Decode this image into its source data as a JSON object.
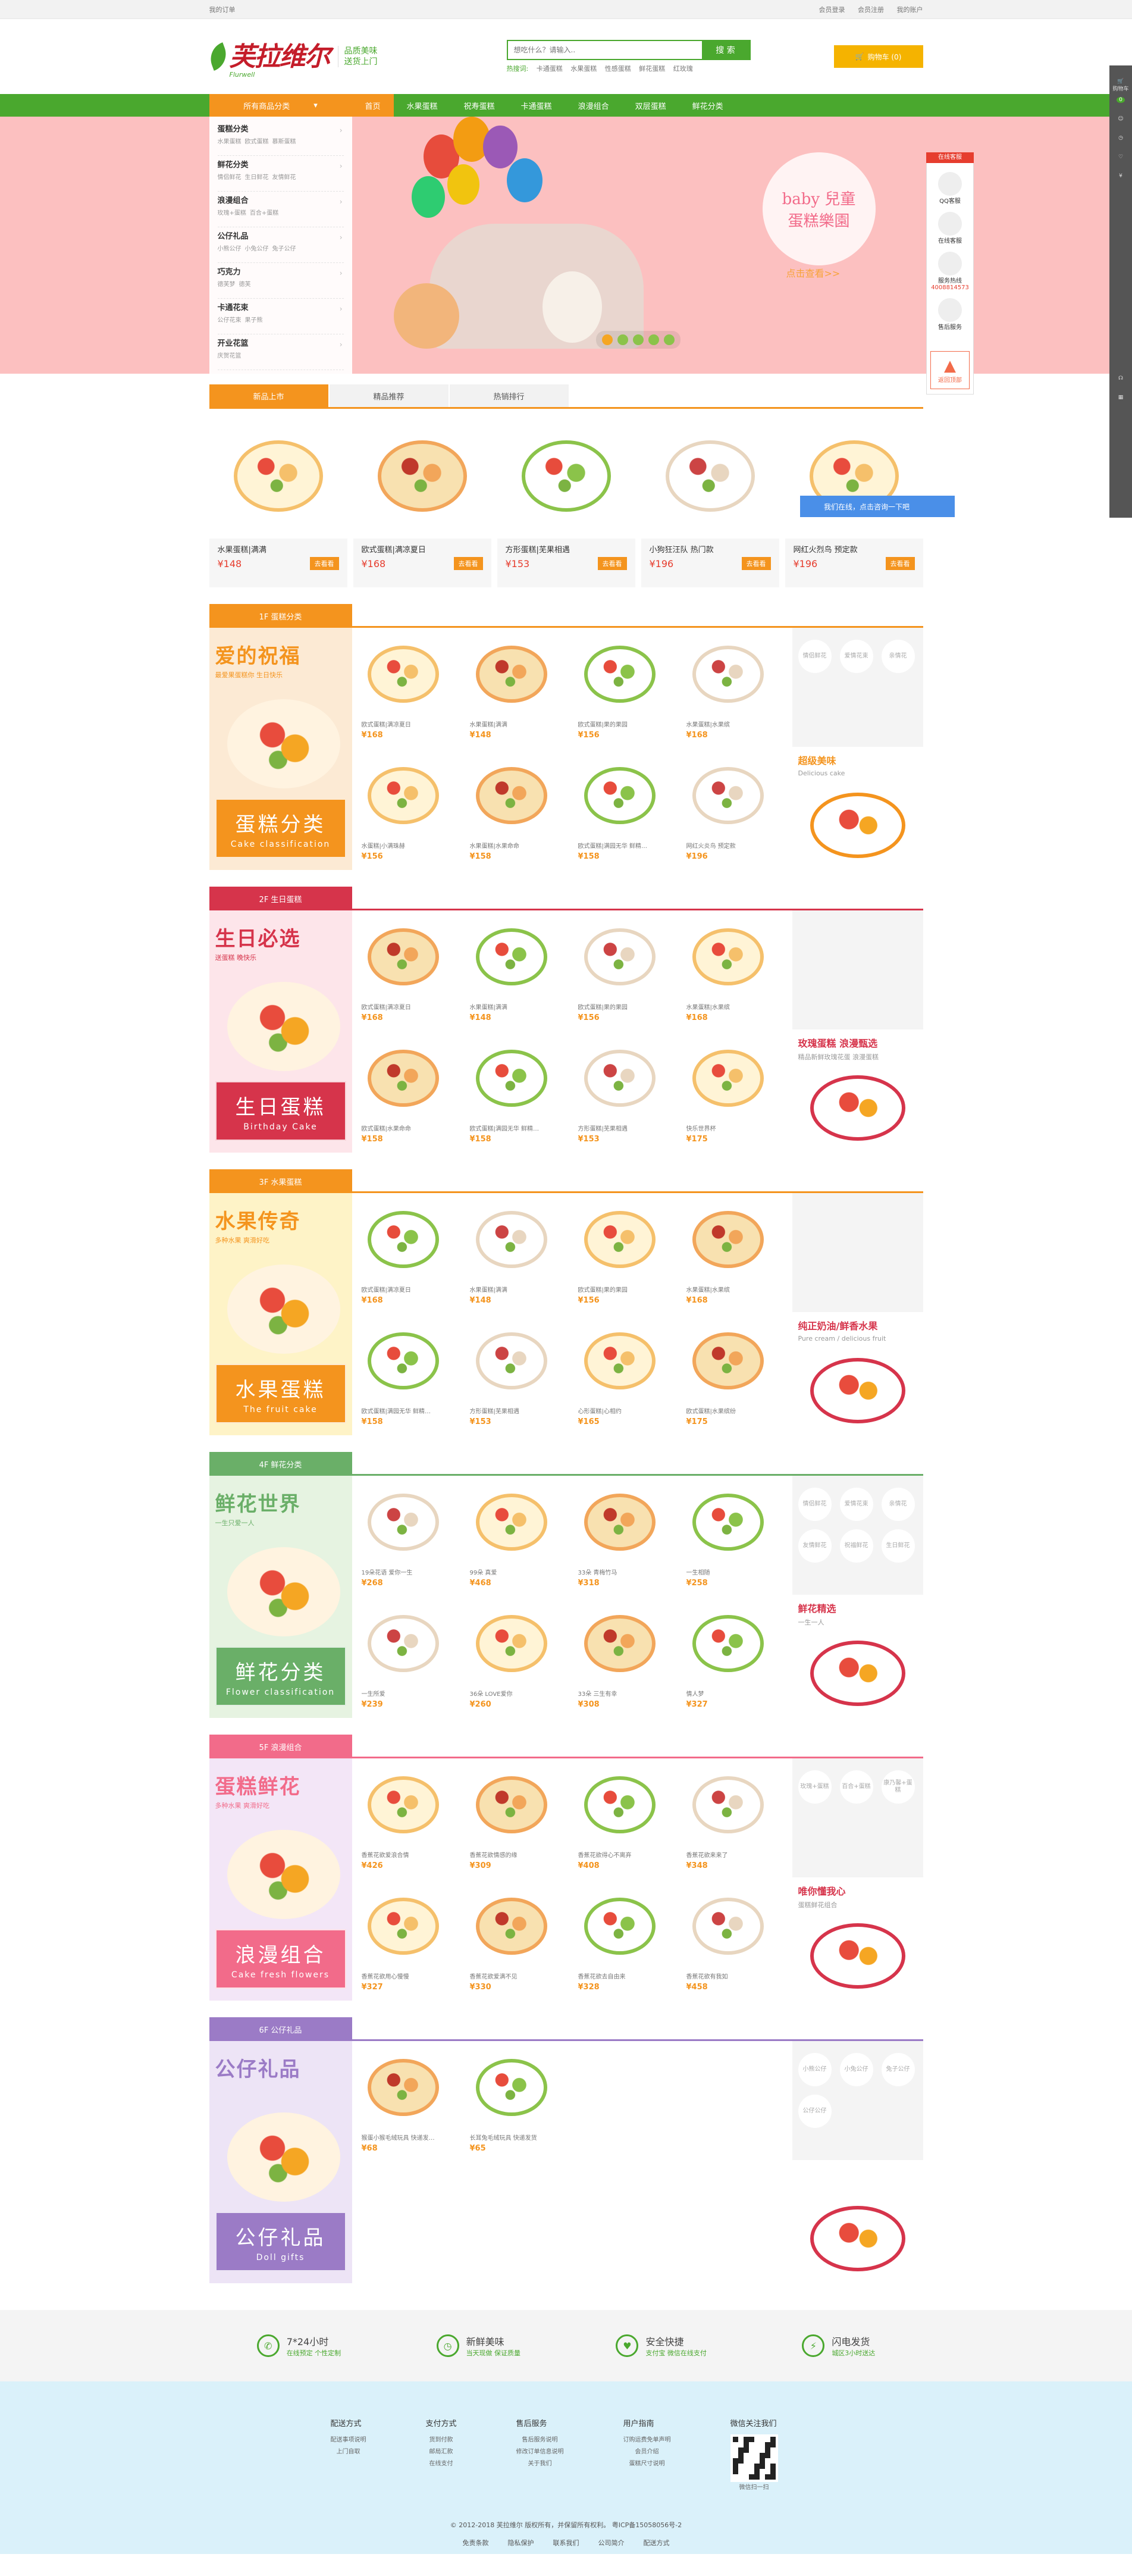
{
  "topbar": {
    "left": "我的订单",
    "links": [
      "会员登录",
      "会员注册",
      "我的账户"
    ]
  },
  "logo": {
    "brand": "芙拉维尔",
    "en": "Flurwell",
    "slogan1": "品质美味",
    "slogan2": "送货上门"
  },
  "search": {
    "placeholder": "想吃什么？请输入..",
    "button": "搜 索",
    "hot": [
      "热搜词:",
      "卡通蛋糕",
      "水果蛋糕",
      "性感蛋糕",
      "鲜花蛋糕",
      "红玫瑰"
    ]
  },
  "cart": {
    "label": "购物车 (0)"
  },
  "nav": {
    "category": "所有商品分类",
    "items": [
      "首页",
      "水果蛋糕",
      "祝寿蛋糕",
      "卡通蛋糕",
      "浪漫组合",
      "双层蛋糕",
      "鲜花分类"
    ]
  },
  "sidebar": [
    {
      "title": "蛋糕分类",
      "subs": [
        "水果蛋糕",
        "欧式蛋糕",
        "慕斯蛋糕"
      ]
    },
    {
      "title": "鲜花分类",
      "subs": [
        "情侣鲜花",
        "生日鲜花",
        "友情鲜花"
      ]
    },
    {
      "title": "浪漫组合",
      "subs": [
        "玫瑰+蛋糕",
        "百合+蛋糕"
      ]
    },
    {
      "title": "公仔礼品",
      "subs": [
        "小熊公仔",
        "小兔公仔",
        "兔子公仔"
      ]
    },
    {
      "title": "巧克力",
      "subs": [
        "德芙梦",
        "德芙"
      ]
    },
    {
      "title": "卡通花束",
      "subs": [
        "公仔花束",
        "果子熊"
      ]
    },
    {
      "title": "开业花篮",
      "subs": [
        "庆贺花篮"
      ]
    }
  ],
  "banner": {
    "title1": "baby 兒童",
    "title2": "蛋糕樂園",
    "sub": "点击查看>>"
  },
  "tabs": [
    "新品上市",
    "精品推荐",
    "热销排行"
  ],
  "new_products": [
    {
      "name": "水果蛋糕|满满",
      "price": "¥148",
      "btn": "去看看"
    },
    {
      "name": "欧式蛋糕|满凉夏日",
      "price": "¥168",
      "btn": "去看看"
    },
    {
      "name": "方形蛋糕|芜果相遇",
      "price": "¥153",
      "btn": "去看看"
    },
    {
      "name": "小狗狂汪队 热门款",
      "price": "¥196",
      "btn": "去看看"
    },
    {
      "name": "网红火烈鸟 预定款",
      "price": "¥196",
      "btn": "去看看"
    }
  ],
  "chat": "我们在线，点击咨询一下吧",
  "floors": [
    {
      "tag": "1F 蛋糕分类",
      "color": "#f4941e",
      "title": "爱的祝福",
      "sub": "最爱果蛋糕你 生日快乐",
      "label_cn": "蛋糕分类",
      "label_en": "Cake classification",
      "bg": "#fcead4",
      "items": [
        [
          "欧式蛋糕|满凉夏日",
          "¥168"
        ],
        [
          "水果蛋糕|满满",
          "¥148"
        ],
        [
          "欧式蛋糕|果的果园",
          "¥156"
        ],
        [
          "水果蛋糕|水果缤",
          "¥168"
        ],
        [
          "水蛋糕|小满珠赫",
          "¥156"
        ],
        [
          "水果蛋糕|水果命命",
          "¥158"
        ],
        [
          "欧式蛋糕|满园无华 鲜精…",
          "¥158"
        ],
        [
          "网红火炎鸟 预定款",
          "¥196"
        ]
      ],
      "tags": [
        "情侣鲜花",
        "爱情花束",
        "亲情花"
      ],
      "pt": "超级美味",
      "ps": "Delicious cake",
      "pcolor": "#f4941e"
    },
    {
      "tag": "2F 生日蛋糕",
      "color": "#d6344b",
      "title": "生日必选",
      "sub": "送蛋糕 晚快乐",
      "label_cn": "生日蛋糕",
      "label_en": "Birthday Cake",
      "bg": "#fde5ea",
      "items": [
        [
          "欧式蛋糕|满凉夏日",
          "¥168"
        ],
        [
          "水果蛋糕|满满",
          "¥148"
        ],
        [
          "欧式蛋糕|果的果园",
          "¥156"
        ],
        [
          "水果蛋糕|水果缤",
          "¥168"
        ],
        [
          "欧式蛋糕|水果命命",
          "¥158"
        ],
        [
          "欧式蛋糕|满园无华 鲜精…",
          "¥158"
        ],
        [
          "方形蛋糕|芜果相遇",
          "¥153"
        ],
        [
          "快乐世界杯",
          "¥175"
        ]
      ],
      "tags": [],
      "pt": "玫瑰蛋糕 浪漫甄选",
      "ps": "精品新鲜玫瑰花蛋 浪漫蛋糕",
      "pcolor": "#d6344b"
    },
    {
      "tag": "3F 水果蛋糕",
      "color": "#f4941e",
      "title": "水果传奇",
      "sub": "多种水果 爽滑好吃",
      "label_cn": "水果蛋糕",
      "label_en": "The fruit cake",
      "bg": "#fef3c7",
      "items": [
        [
          "欧式蛋糕|满凉夏日",
          "¥168"
        ],
        [
          "水果蛋糕|满满",
          "¥148"
        ],
        [
          "欧式蛋糕|果的果园",
          "¥156"
        ],
        [
          "水果蛋糕|水果缤",
          "¥168"
        ],
        [
          "欧式蛋糕|满园无华 鲜精…",
          "¥158"
        ],
        [
          "方形蛋糕|芜果相遇",
          "¥153"
        ],
        [
          "心形蛋糕|心相约",
          "¥165"
        ],
        [
          "欧式蛋糕|水果缤纷",
          "¥175"
        ]
      ],
      "tags": [],
      "pt": "纯正奶油/鲜香水果",
      "ps": "Pure cream / delicious fruit",
      "pcolor": "#d6344b"
    },
    {
      "tag": "4F 鲜花分类",
      "color": "#6aaf68",
      "title": "鲜花世界",
      "sub": "一生只爱一人",
      "label_cn": "鲜花分类",
      "label_en": "Flower classification",
      "bg": "#e6f3e1",
      "items": [
        [
          "19朵花语 爱你一生",
          "¥268"
        ],
        [
          "99朵 真爱",
          "¥468"
        ],
        [
          "33朵 青梅竹马",
          "¥318"
        ],
        [
          "一生相随",
          "¥258"
        ],
        [
          "一生所爱",
          "¥239"
        ],
        [
          "36朵 LOVE爱你",
          "¥260"
        ],
        [
          "33朵 三生有幸",
          "¥308"
        ],
        [
          "情人梦",
          "¥327"
        ]
      ],
      "tags": [
        "情侣鲜花",
        "爱情花束",
        "亲情花",
        "友情鲜花",
        "祝福鲜花",
        "生日鲜花"
      ],
      "pt": "鲜花精选",
      "ps": "一生一人",
      "pcolor": "#d6344b"
    },
    {
      "tag": "5F 浪漫组合",
      "color": "#f26b8a",
      "title": "蛋糕鲜花",
      "sub": "多种水果 爽滑好吃",
      "label_cn": "浪漫组合",
      "label_en": "Cake fresh flowers",
      "bg": "#f3e6f7",
      "items": [
        [
          "香蕉花欲爱浪合情",
          "¥426"
        ],
        [
          "香蕉花欲情感的缘",
          "¥309"
        ],
        [
          "香蕉花欲得心不离弃",
          "¥408"
        ],
        [
          "香蕉花欲来来了",
          "¥348"
        ],
        [
          "香蕉花欲用心慢慢",
          "¥327"
        ],
        [
          "香蕉花欲爱满不见",
          "¥330"
        ],
        [
          "香蕉花欲去自由来",
          "¥328"
        ],
        [
          "香蕉花欲有我如",
          "¥458"
        ]
      ],
      "tags": [
        "玫瑰+蛋糕",
        "百合+蛋糕",
        "康乃馨+蛋糕"
      ],
      "pt": "唯你懂我心",
      "ps": "蛋糕鲜花组合",
      "pcolor": "#d6344b"
    },
    {
      "tag": "6F 公仔礼品",
      "color": "#9b7bc6",
      "title": "公仔礼品",
      "sub": "",
      "label_cn": "公仔礼品",
      "label_en": "Doll gifts",
      "bg": "#ede4f6",
      "items": [
        [
          "猴蛋小猴毛绒玩具 快递发…",
          "¥68"
        ],
        [
          "长耳兔毛绒玩具 快递发货",
          "¥65"
        ]
      ],
      "tags": [
        "小熊公仔",
        "小兔公仔",
        "兔子公仔",
        "公仔公仔"
      ],
      "pt": "",
      "ps": "",
      "pcolor": "#d6344b"
    }
  ],
  "services": [
    {
      "icon": "✆",
      "title": "7*24小时",
      "sub": "在线预定 个性定制"
    },
    {
      "icon": "◷",
      "title": "新鲜美味",
      "sub": "当天现做 保证质量"
    },
    {
      "icon": "♥",
      "title": "安全快捷",
      "sub": "支付宝 微信在线支付"
    },
    {
      "icon": "⚡",
      "title": "闪电发货",
      "sub": "城区3小时送达"
    }
  ],
  "footer_cols": [
    {
      "title": "配送方式",
      "items": [
        "配送事项说明",
        "上门自取"
      ]
    },
    {
      "title": "支付方式",
      "items": [
        "货到付款",
        "邮局汇款",
        "在线支付"
      ]
    },
    {
      "title": "售后服务",
      "items": [
        "售后服务说明",
        "修改订单信息说明",
        "关于我们"
      ]
    },
    {
      "title": "用户指南",
      "items": [
        "订购运费免单声明",
        "会员介绍",
        "蛋糕尺寸说明"
      ]
    },
    {
      "title": "微信关注我们",
      "items": [
        "微信扫一扫"
      ]
    }
  ],
  "copyright": "© 2012-2018 芙拉维尔 版权所有，并保留所有权利。 粤ICP备15058056号-2",
  "bottom_links": [
    "免责条款",
    "隐私保护",
    "联系我们",
    "公司简介",
    "配送方式"
  ],
  "kefu": {
    "title": "在线客服",
    "qq": "QQ客服",
    "online": "在线客服",
    "phone_t": "服务热线",
    "phone": "4008814573",
    "after": "售后服务",
    "top": "返回顶部"
  },
  "rside": [
    "购物车",
    "0"
  ]
}
